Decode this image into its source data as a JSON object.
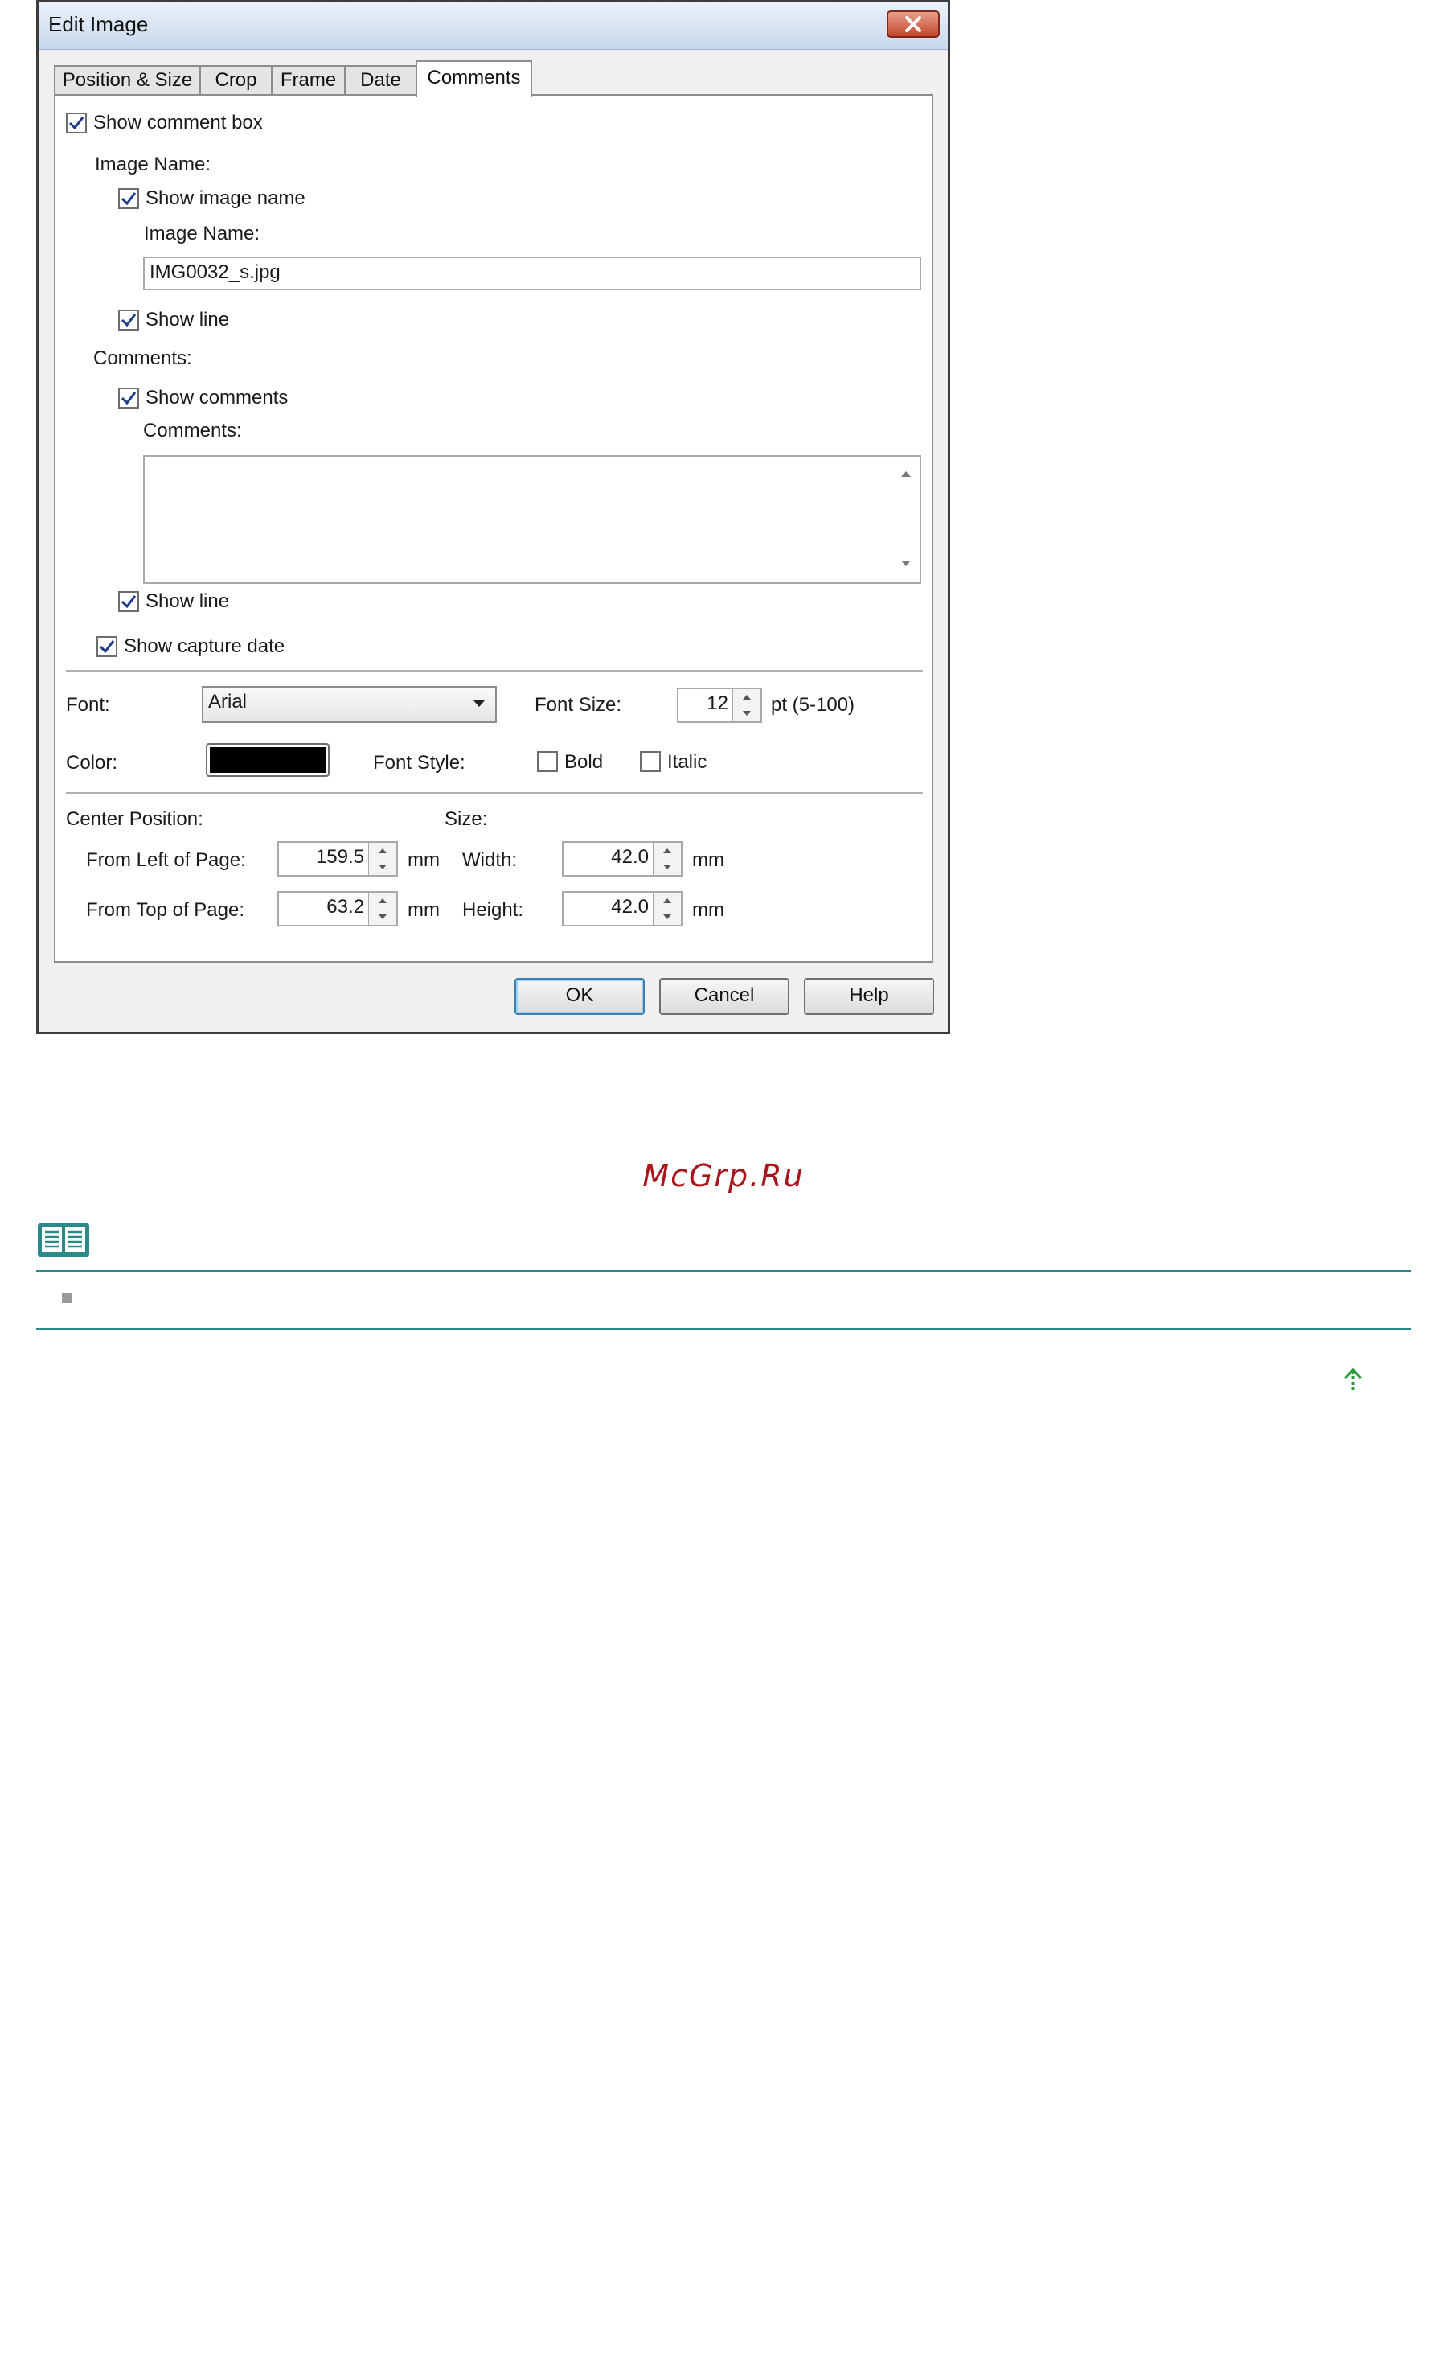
{
  "dialog": {
    "title": "Edit Image",
    "tabs": [
      "Position & Size",
      "Crop",
      "Frame",
      "Date",
      "Comments"
    ],
    "active_tab": "Comments",
    "show_comment_box": {
      "label": "Show comment box",
      "checked": true
    },
    "image_name_group": "Image Name:",
    "show_image_name": {
      "label": "Show image name",
      "checked": true
    },
    "image_name_label": "Image Name:",
    "image_name_value": "IMG0032_s.jpg",
    "show_line_1": {
      "label": "Show line",
      "checked": true
    },
    "comments_group": "Comments:",
    "show_comments": {
      "label": "Show comments",
      "checked": true
    },
    "comments_label": "Comments:",
    "comments_value": "",
    "show_line_2": {
      "label": "Show line",
      "checked": true
    },
    "show_capture_date": {
      "label": "Show capture date",
      "checked": true
    },
    "font_label": "Font:",
    "font_value": "Arial",
    "font_size_label": "Font Size:",
    "font_size_value": "12",
    "font_size_unit": "pt (5-100)",
    "color_label": "Color:",
    "color_value": "#000000",
    "font_style_label": "Font Style:",
    "bold": {
      "label": "Bold",
      "checked": false
    },
    "italic": {
      "label": "Italic",
      "checked": false
    },
    "center_position_label": "Center Position:",
    "from_left_label": "From Left of Page:",
    "from_left_value": "159.5",
    "from_top_label": "From Top of Page:",
    "from_top_value": "63.2",
    "unit_mm": "mm",
    "size_label": "Size:",
    "width_label": "Width:",
    "width_value": "42.0",
    "height_label": "Height:",
    "height_value": "42.0",
    "ok_label": "OK",
    "cancel_label": "Cancel",
    "help_label": "Help"
  },
  "watermark": "McGrp.Ru",
  "note_icon": "book-icon",
  "page_top_icon": "arrow-up-icon",
  "accent_color": "#2a8a88"
}
